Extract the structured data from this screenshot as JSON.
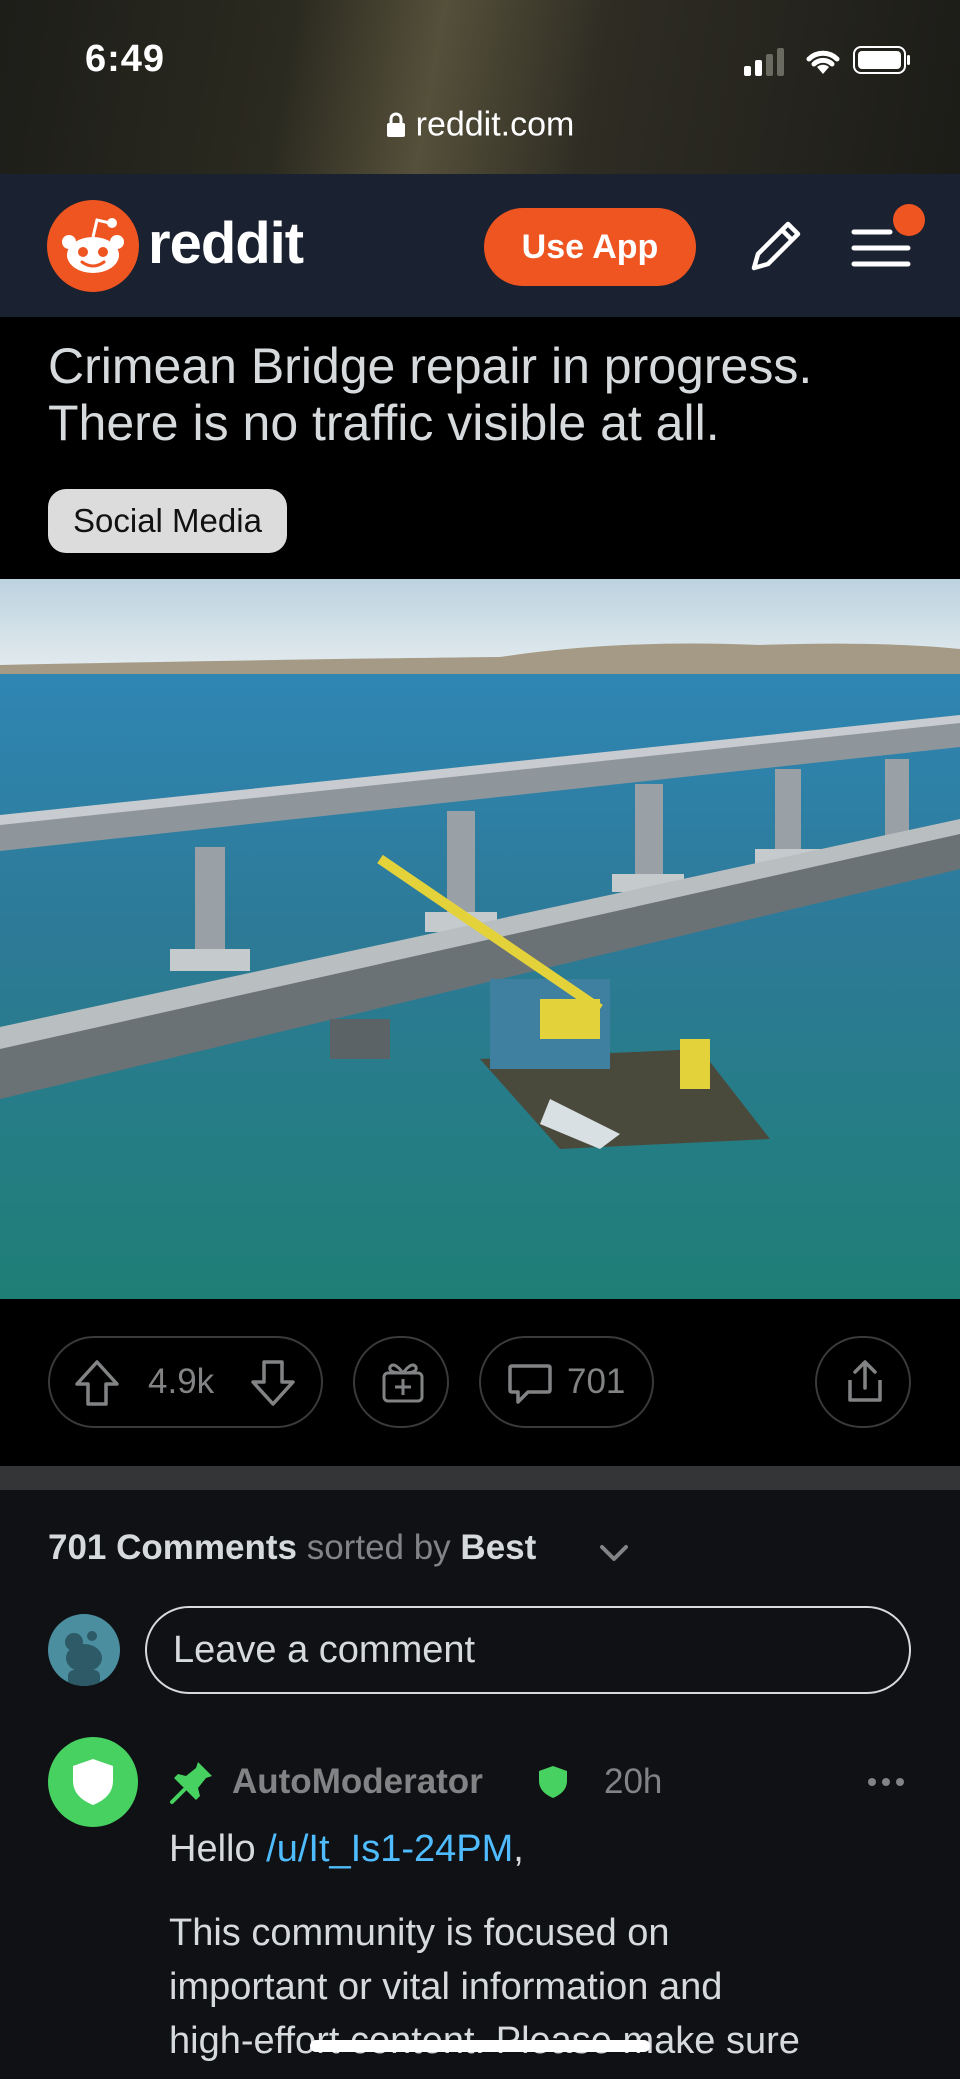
{
  "status_bar": {
    "time": "6:49"
  },
  "browser": {
    "url": "reddit.com"
  },
  "header": {
    "brand": "reddit",
    "use_app_label": "Use App"
  },
  "post": {
    "title_line1": "Crimean Bridge repair in progress.",
    "title_line2": "There is no traffic visible at all.",
    "flair": "Social Media",
    "vote_count": "4.9k",
    "comment_count": "701"
  },
  "comments": {
    "header_count": "701 Comments",
    "sorted_by_label": "sorted by",
    "sort_value": "Best",
    "input_placeholder": "Leave a comment",
    "items": [
      {
        "author": "AutoModerator",
        "age": "20h",
        "greeting": "Hello",
        "user_link": "/u/It_Is1-24PM",
        "greeting_end": ",",
        "body_line1": "This community is focused on",
        "body_line2": "important or vital information and",
        "body_line3": "high-effort content. Please make sure"
      }
    ]
  },
  "colors": {
    "accent": "#ee5521",
    "header_bg": "#1a2130",
    "mod_green": "#46d160",
    "link": "#4fbcff"
  },
  "icons": [
    "lock-icon",
    "signal-icon",
    "wifi-icon",
    "battery-icon",
    "reddit-logo-icon",
    "pencil-icon",
    "menu-icon",
    "upvote-icon",
    "downvote-icon",
    "award-icon",
    "comment-icon",
    "share-icon",
    "chevron-down-icon",
    "pin-icon",
    "mod-shield-icon",
    "more-icon"
  ]
}
